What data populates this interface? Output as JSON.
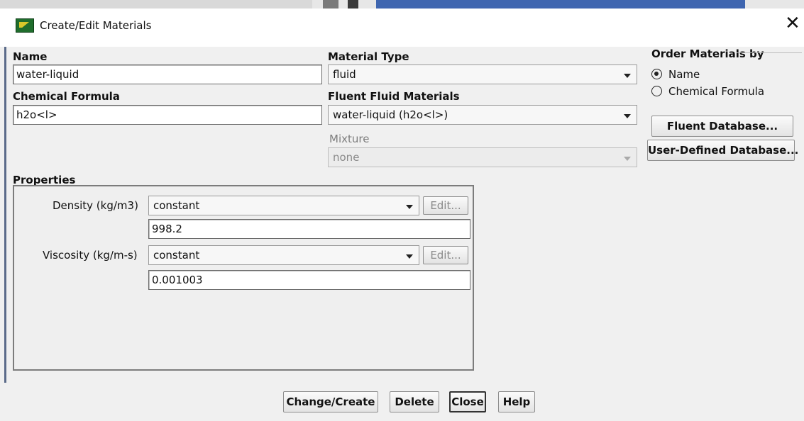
{
  "dialog": {
    "title": "Create/Edit Materials"
  },
  "name_field": {
    "label": "Name",
    "value": "water-liquid"
  },
  "formula_field": {
    "label": "Chemical Formula",
    "value": "h2o<l>"
  },
  "material_type": {
    "label": "Material Type",
    "value": "fluid"
  },
  "fluent_materials": {
    "label": "Fluent Fluid Materials",
    "value": "water-liquid (h2o<l>)"
  },
  "mixture": {
    "label": "Mixture",
    "value": "none"
  },
  "order_by": {
    "label": "Order Materials by",
    "options": [
      {
        "label": "Name",
        "selected": true
      },
      {
        "label": "Chemical Formula",
        "selected": false
      }
    ]
  },
  "database_buttons": {
    "fluent": "Fluent Database...",
    "user": "User-Defined Database..."
  },
  "properties": {
    "label": "Properties",
    "density": {
      "label": "Density (kg/m3)",
      "method": "constant",
      "edit": "Edit...",
      "value": "998.2"
    },
    "viscosity": {
      "label": "Viscosity (kg/m-s)",
      "method": "constant",
      "edit": "Edit...",
      "value": "0.001003"
    }
  },
  "buttons": {
    "change_create": "Change/Create",
    "delete": "Delete",
    "close": "Close",
    "help": "Help"
  },
  "icons": {
    "app": "fluent-app-icon",
    "close": "close-icon",
    "dropdown": "chevron-down-icon"
  },
  "colors": {
    "background": "#f0f0f0",
    "field_border": "#6a6a6a",
    "title_icon": "#1f6d2c"
  }
}
